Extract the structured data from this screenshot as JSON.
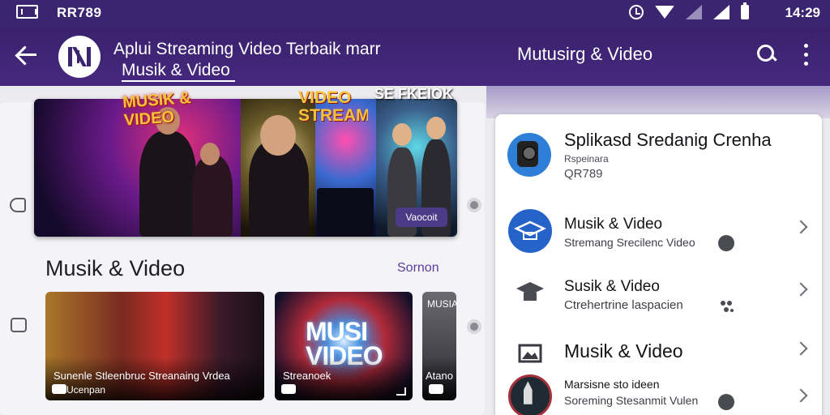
{
  "status_bar": {
    "carrier": "RR789",
    "time": "14:29"
  },
  "app_bar": {
    "title": "Aplui Streaming Video Terbaik marr",
    "subtitle": "Musik & Video",
    "center_title": "Mutusirg & Video"
  },
  "hero": {
    "text_1": "MUSIK & VIDEO",
    "text_2": "VIDEO STREAM",
    "text_3": "SE FKEIOK",
    "button_label": "Vaocoit"
  },
  "section": {
    "title": "Musik & Video",
    "link": "Sornon"
  },
  "tiles": [
    {
      "caption": "Sunenle Stleenbruc Streanaing Vrdea",
      "sub": "Ucenpan"
    },
    {
      "logo": "MUSI VIDEO",
      "caption": "Streanoek"
    },
    {
      "label": "MUSIA",
      "caption": "Atano"
    }
  ],
  "detail": {
    "title": "Splikasd Sredanig Crenha",
    "subtitle": "Rspeinara",
    "code": "QR789"
  },
  "list": [
    {
      "title": "Musik & Video",
      "sub": "Stremang Srecilenc Video"
    },
    {
      "title": "Susik & Video",
      "sub": "Ctrehertrine laspacien"
    },
    {
      "title": "Musik & Video",
      "sub": ""
    },
    {
      "title": "Marsisne sto ideen",
      "sub": "Soreming Stesanmit Vulen"
    }
  ]
}
